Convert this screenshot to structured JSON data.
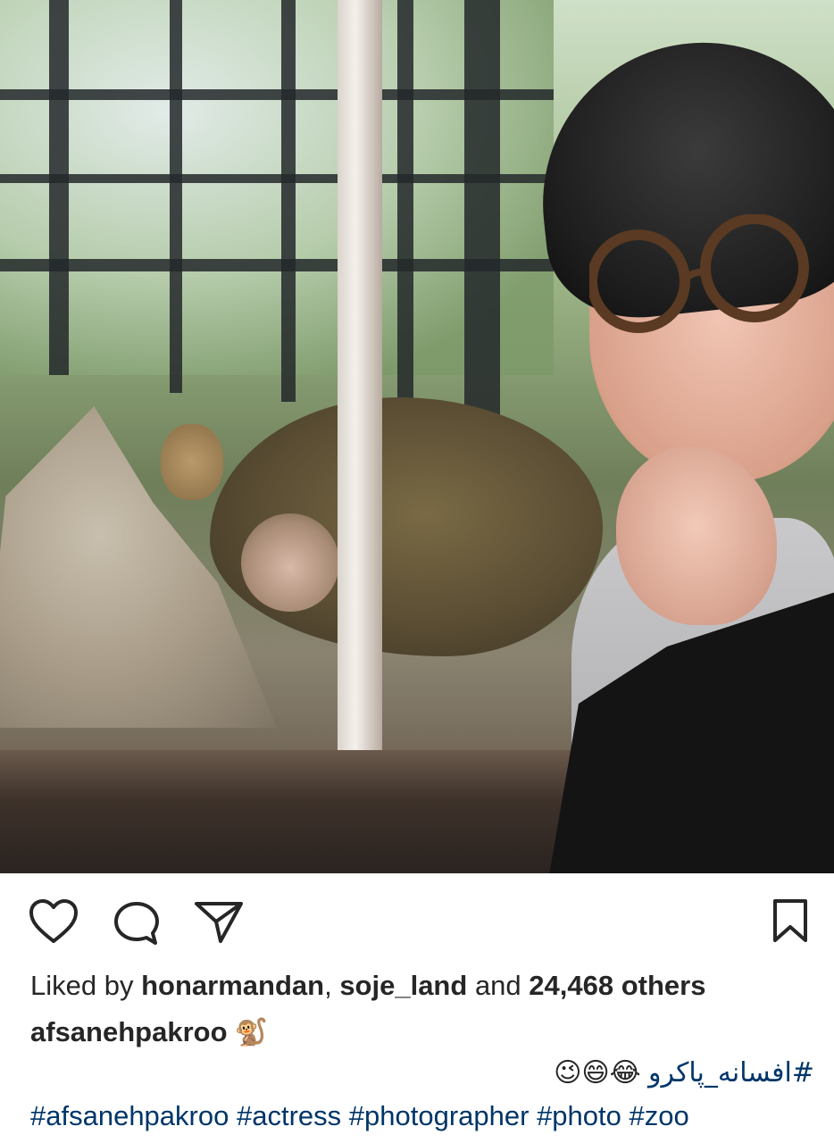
{
  "post": {
    "photo_alt": "",
    "actions": {
      "like_icon": "heart-icon",
      "comment_icon": "comment-icon",
      "share_icon": "paper-plane-icon",
      "save_icon": "bookmark-icon"
    },
    "likes": {
      "prefix": "Liked by",
      "user1": "honarmandan",
      "separator": ",",
      "user2": "soje_land",
      "conjunction": "and",
      "others": "24,468 others"
    },
    "caption": {
      "username": "afsanehpakroo",
      "user_emoji": "🐒",
      "persian_hashtag": "#افسانه_پاکرو",
      "emojis": "😂😄😉",
      "hashtags": [
        "#afsanehpakroo",
        "#actress",
        "#photographer",
        "#photo",
        "#zoo"
      ]
    }
  }
}
